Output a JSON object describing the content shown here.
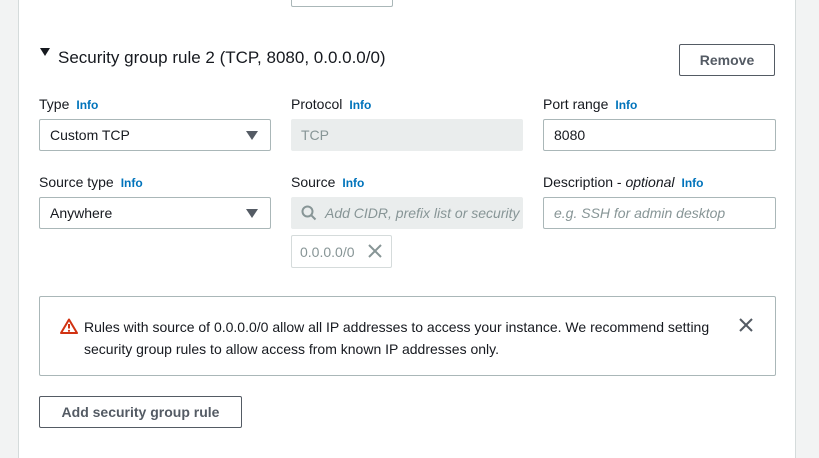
{
  "rule": {
    "title": "Security group rule 2 (TCP, 8080, 0.0.0.0/0)",
    "remove_label": "Remove"
  },
  "info_label": "Info",
  "fields": {
    "type": {
      "label": "Type",
      "value": "Custom TCP"
    },
    "protocol": {
      "label": "Protocol",
      "value": "TCP"
    },
    "port_range": {
      "label": "Port range",
      "value": "8080"
    },
    "source_type": {
      "label": "Source type",
      "value": "Anywhere"
    },
    "source": {
      "label": "Source",
      "placeholder": "Add CIDR, prefix list or security",
      "chip": "0.0.0.0/0"
    },
    "description": {
      "label": "Description - ",
      "label_optional": "optional",
      "placeholder": "e.g. SSH for admin desktop"
    }
  },
  "alert": {
    "text": "Rules with source of 0.0.0.0/0 allow all IP addresses to access your instance. We recommend setting security group rules to allow access from known IP addresses only.",
    "icon": "warning-icon",
    "color": "#d13212"
  },
  "add_rule_label": "Add security group rule",
  "colors": {
    "link": "#0073bb",
    "text": "#16191f",
    "border": "#aab7b8"
  }
}
